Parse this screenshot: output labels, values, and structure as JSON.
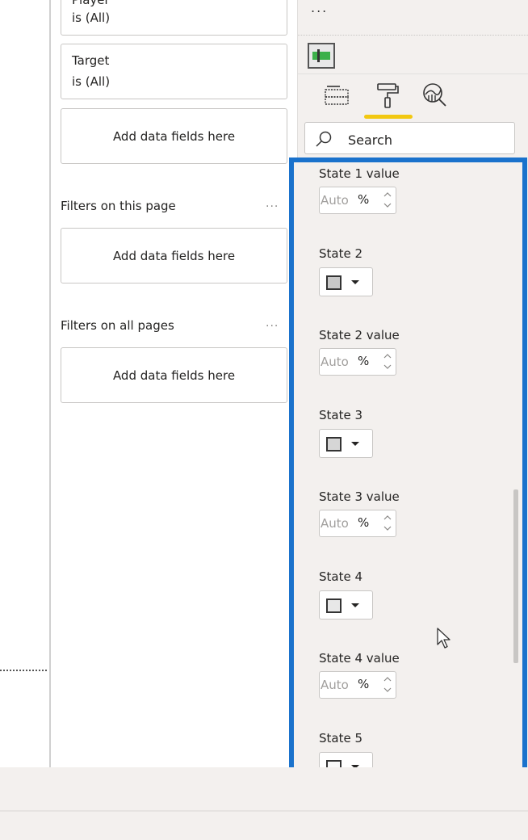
{
  "filters_pane": {
    "visual_filters": [
      {
        "field": "Player",
        "condition": "is (All)"
      },
      {
        "field": "Target",
        "condition": "is (All)"
      }
    ],
    "visual_add_label": "Add data fields here",
    "page_section": {
      "label": "Filters on this page",
      "more": "...",
      "add_label": "Add data fields here"
    },
    "all_section": {
      "label": "Filters on all pages",
      "more": "...",
      "add_label": "Add data fields here"
    }
  },
  "viz_pane": {
    "more": "...",
    "tabs": [
      {
        "name": "fields",
        "icon": "fields-icon",
        "active": false
      },
      {
        "name": "format",
        "icon": "paint-roller-icon",
        "active": true
      },
      {
        "name": "analytics",
        "icon": "analytics-icon",
        "active": false
      }
    ],
    "active_tab_color": "#f2c811",
    "search": {
      "placeholder": "Search"
    }
  },
  "format_list": {
    "highlight_color": "#1a72cc",
    "items": [
      {
        "type": "spin",
        "label": "State 1 value",
        "value": "Auto",
        "unit": "%"
      },
      {
        "type": "color",
        "label": "State 2",
        "color": "#c8c8c8"
      },
      {
        "type": "spin",
        "label": "State 2 value",
        "value": "Auto",
        "unit": "%"
      },
      {
        "type": "color",
        "label": "State 3",
        "color": "#d6d6d6"
      },
      {
        "type": "spin",
        "label": "State 3 value",
        "value": "Auto",
        "unit": "%"
      },
      {
        "type": "color",
        "label": "State 4",
        "color": "#e8e8e8"
      },
      {
        "type": "spin",
        "label": "State 4 value",
        "value": "Auto",
        "unit": "%"
      },
      {
        "type": "color",
        "label": "State 5",
        "color": "#f8f8f8"
      }
    ]
  }
}
